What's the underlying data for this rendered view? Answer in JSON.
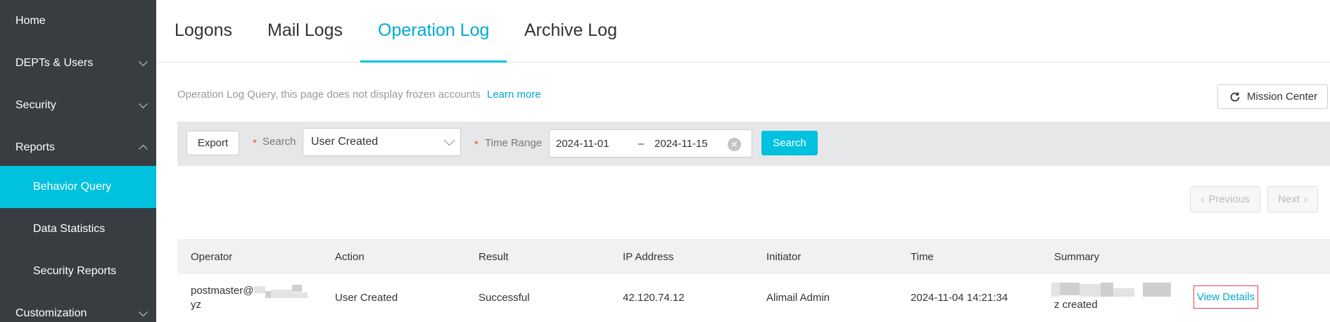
{
  "sidebar": {
    "items": [
      {
        "label": "Home"
      },
      {
        "label": "DEPTs & Users"
      },
      {
        "label": "Security"
      },
      {
        "label": "Reports"
      },
      {
        "label": "Behavior Query"
      },
      {
        "label": "Data Statistics"
      },
      {
        "label": "Security Reports"
      },
      {
        "label": "Customization"
      }
    ]
  },
  "tabs": [
    {
      "label": "Logons"
    },
    {
      "label": "Mail Logs"
    },
    {
      "label": "Operation Log"
    },
    {
      "label": "Archive Log"
    }
  ],
  "info": {
    "text": "Operation Log Query, this page does not display frozen accounts",
    "learn_more": "Learn more",
    "mission_center": "Mission Center"
  },
  "query": {
    "export_label": "Export",
    "required_mark": "*",
    "search_label": "Search",
    "search_value": "User Created",
    "time_range_label": "Time Range",
    "date_from": "2024-11-01",
    "date_sep": "–",
    "date_to": "2024-11-15",
    "search_button": "Search"
  },
  "pagination": {
    "previous": "Previous",
    "next": "Next"
  },
  "table": {
    "columns": [
      "Operator",
      "Action",
      "Result",
      "IP Address",
      "Initiator",
      "Time",
      "Summary"
    ],
    "rows": [
      {
        "operator_line1": "postmaster@",
        "operator_line2": "yz",
        "action": "User Created",
        "result": "Successful",
        "ip": "42.120.74.12",
        "initiator": "Alimail Admin",
        "time": "2024-11-04 14:21:34",
        "summary_tail": "z created",
        "link": "View Details"
      }
    ]
  },
  "colors": {
    "sidebar_bg": "#373d41",
    "accent": "#00c1de",
    "link": "#00a9d6",
    "highlight_border": "#e0414a"
  }
}
